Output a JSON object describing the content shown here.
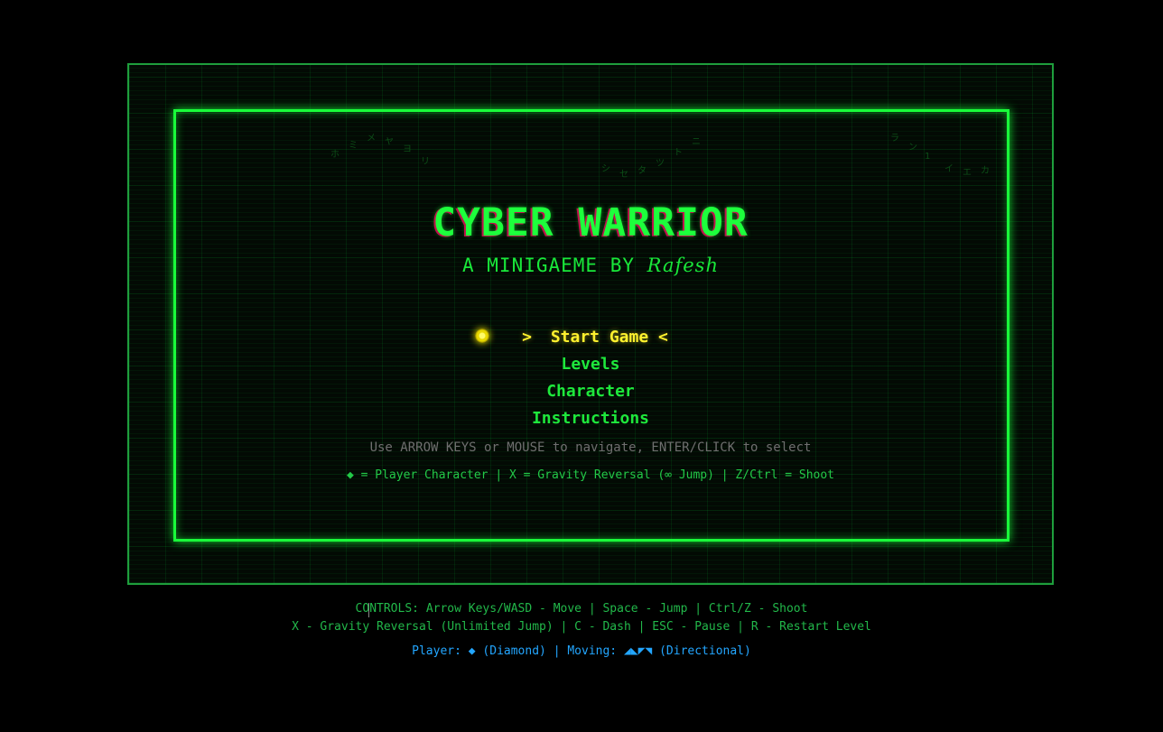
{
  "game": {
    "title": "CYBER WARRIOR",
    "subtitle_prefix": "A MINIGAEME BY",
    "author": "Rafesh"
  },
  "menu": {
    "items": [
      {
        "label": "Start Game",
        "selected": true,
        "left_arrow": ">",
        "right_arrow": "<"
      },
      {
        "label": "Levels"
      },
      {
        "label": "Character"
      },
      {
        "label": "Instructions"
      }
    ]
  },
  "hint": "Use ARROW KEYS or MOUSE to navigate, ENTER/CLICK to select",
  "legend": "◆ = Player Character | X = Gravity Reversal (∞ Jump) | Z/Ctrl = Shoot",
  "matrix_rain": [
    "メ",
    "ミ",
    "ホ",
    "ヤ",
    "ヨ",
    "リ",
    "ト",
    "ツ",
    "タ",
    "セ",
    "シ",
    "ニ",
    "ラ",
    "ン",
    "1",
    "イ",
    "エ",
    "カ"
  ],
  "controls": {
    "line1": "CONTROLS: Arrow Keys/WASD - Move | Space - Jump | Ctrl/Z - Shoot",
    "line2": "X - Gravity Reversal (Unlimited Jump) | C - Dash | ESC - Pause | R - Restart Level",
    "player_line": "Player: ◆ (Diamond) | Moving: ◢◣◤◥ (Directional)"
  },
  "colors": {
    "primary_green": "#19ff3a",
    "selected_yellow": "#fff12e",
    "info_blue": "#23a6ff",
    "background": "#000000"
  }
}
